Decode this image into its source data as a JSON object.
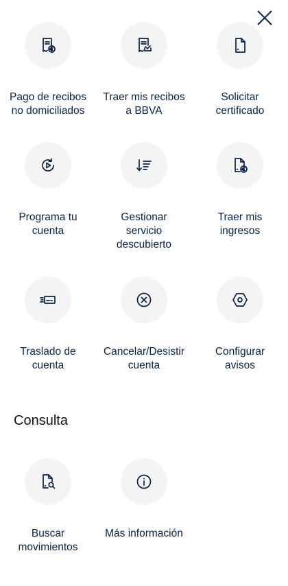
{
  "header": {
    "close_icon": "close-icon"
  },
  "operations": {
    "items": [
      {
        "label": "Pago de recibos\nno domiciliados",
        "icon": "receipt-euro-icon"
      },
      {
        "label": "Traer mis recibos\na BBVA",
        "icon": "receipt-import-icon"
      },
      {
        "label": "Solicitar\ncertificado",
        "icon": "document-icon"
      },
      {
        "label": "Programa tu\ncuenta",
        "icon": "schedule-refresh-icon"
      },
      {
        "label": "Gestionar\nservicio\ndescubierto",
        "icon": "sort-list-icon"
      },
      {
        "label": "Traer mis\ningresos",
        "icon": "document-euro-icon"
      },
      {
        "label": "Traslado de\ncuenta",
        "icon": "card-transfer-icon"
      },
      {
        "label": "Cancelar/Desistir\ncuenta",
        "icon": "cancel-circle-icon"
      },
      {
        "label": "Configurar\navisos",
        "icon": "settings-hexagon-icon"
      }
    ]
  },
  "consulta": {
    "title": "Consulta",
    "items": [
      {
        "label": "Buscar\nmovimientos",
        "icon": "document-search-icon"
      },
      {
        "label": "Más información",
        "icon": "info-icon"
      }
    ]
  },
  "colors": {
    "primary_text": "#072146",
    "icon_background": "#f4f4f4",
    "background": "#ffffff"
  }
}
